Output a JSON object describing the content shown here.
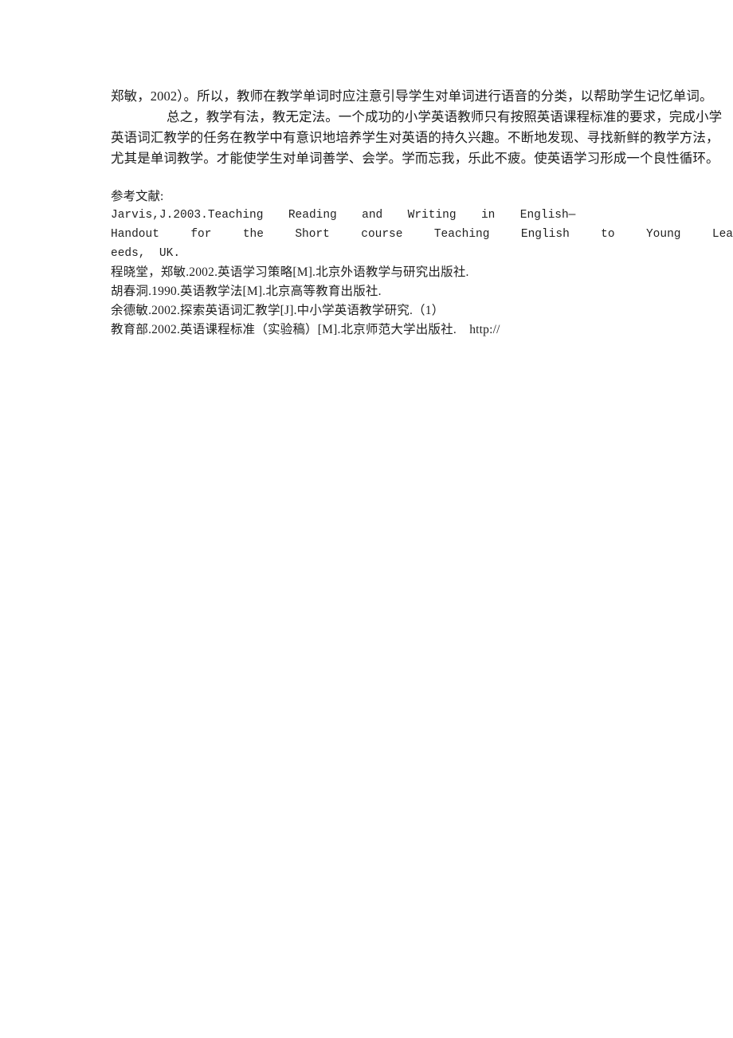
{
  "document": {
    "page_background": "#ffffff",
    "text_color": "#1c1c1c",
    "body": {
      "lines": [
        "郑敏，2002）。所以，教师在教学单词时应注意引导学生对单词进行语音的分类，以帮助学生记忆单词。",
        "总之，教学有法，教无定法。一个成功的小学英语教师只有按照英语课程标准的要求，完成小学",
        "英语词汇教学的任务在教学中有意识地培养学生对英语的持久兴趣。不断地发现、寻找新鲜的教学方法，",
        "尤其是单词教学。才能使学生对单词善学、会学。学而忘我，乐此不疲。使英语学习形成一个良性循环。"
      ]
    },
    "references": {
      "heading": "参考文献:",
      "entries": [
        "Jarvis,J.2003.Teaching  Reading  and  Writing  in  English—",
        "Handout  for  the  Short  course  Teaching  English  to  Young  Learners[M].University of L",
        "eeds,  UK.",
        "程晓堂，郑敏.2002.英语学习策略[M].北京外语教学与研究出版社.",
        "胡春洞.1990.英语教学法[M].北京高等教育出版社.",
        "余德敏.2002.探索英语词汇教学[J].中小学英语教学研究.（1）",
        "教育部.2002.英语课程标准（实验稿）[M].北京师范大学出版社.    http://"
      ]
    }
  }
}
